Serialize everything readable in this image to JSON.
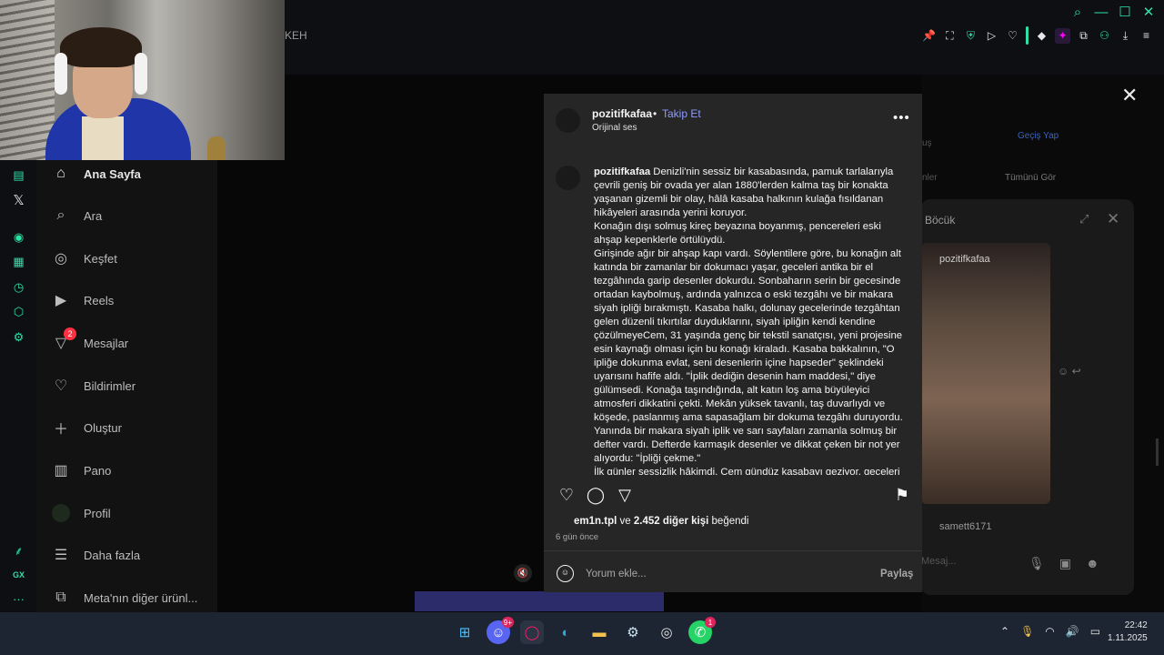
{
  "browser": {
    "tab_fragment": "KEH"
  },
  "rail": {
    "gx_label": "GX",
    "more_label": "···"
  },
  "nav": {
    "home": "Ana Sayfa",
    "search": "Ara",
    "explore": "Keşfet",
    "reels": "Reels",
    "messages": "Mesajlar",
    "messages_badge": "2",
    "notifications": "Bildirimler",
    "create": "Oluştur",
    "dashboard": "Pano",
    "profile": "Profil",
    "more": "Daha fazla",
    "meta": "Meta'nın diğer ürünl..."
  },
  "background": {
    "switch": "Geçiş Yap",
    "see_all": "Tümünü Gör",
    "frag1": "uş",
    "frag2": "nler"
  },
  "chat": {
    "title": "Böcük",
    "video_user": "pozitifkafaa",
    "reply_user": "samett6171",
    "input_placeholder": "Mesaj..."
  },
  "post": {
    "username": "pozitifkafaa",
    "dot": "•",
    "follow": "Takip Et",
    "audio": "Orijinal ses",
    "caption_user": "pozitifkafaa",
    "caption_text": "Denizli'nin sessiz bir kasabasında, pamuk tarlalarıyla çevrili geniş bir ovada yer alan 1880'lerden kalma taş bir konakta yaşanan gizemli bir olay, hâlâ kasaba halkının kulağa fısıldanan hikâyeleri arasında yerini koruyor.",
    "caption_p2": "Konağın dışı solmuş kireç beyazına boyanmış, pencereleri eski ahşap kepenklerle örtülüydü.",
    "caption_p3": "Girişinde ağır bir ahşap kapı vardı. Söylentilere göre, bu konağın alt katında bir zamanlar bir dokumacı yaşar, geceleri antika bir el tezgâhında garip desenler dokurdu. Sonbaharın serin bir gecesinde ortadan kaybolmuş, ardında yalnızca o eski tezgâhı ve bir makara siyah ipliği bırakmıştı. Kasaba halkı, dolunay gecelerinde tezgâhtan gelen düzenli tıkırtılar duyduklarını, siyah ipliğin kendi kendine çözülmeyeCem, 31 yaşında genç bir tekstil sanatçısı, yeni projesine esin kaynağı olması için bu konağı kiraladı. Kasaba bakkalının, \"O ipliğe dokunma evlat, seni desenlerin içine hapseder\" şeklindeki uyarısını hafife aldı. \"İplik dediğin desenin ham maddesi,\" diye gülümsedi. Konağa taşındığında, alt katın loş ama büyüleyici atmosferi dikkatini çekti. Mekân yüksek tavanlı, taş duvarlıydı ve köşede, paslanmış ama sapasağlam bir dokuma tezgâhı duruyordu. Yanında bir makara siyah iplik ve sarı sayfaları zamanla solmuş bir defter vardı. Defterde karmaşık desenler ve dikkat çeken bir not yer alıyordu: \"İpliği çekme.\"",
    "caption_p4": "İlk günler sessizlik hâkimdi. Cem gündüz kasabayı geziyor, geceleri",
    "likes_user": "em1n.tpl",
    "likes_and": "ve",
    "likes_count": "2.452 diğer kişi",
    "likes_suffix": "beğendi",
    "time": "6 gün önce",
    "comment_placeholder": "Yorum ekle...",
    "share": "Paylaş"
  },
  "taskbar": {
    "discord_badge": "9+",
    "whatsapp_badge": "1",
    "time": "22:42",
    "date": "1.11.2025"
  }
}
